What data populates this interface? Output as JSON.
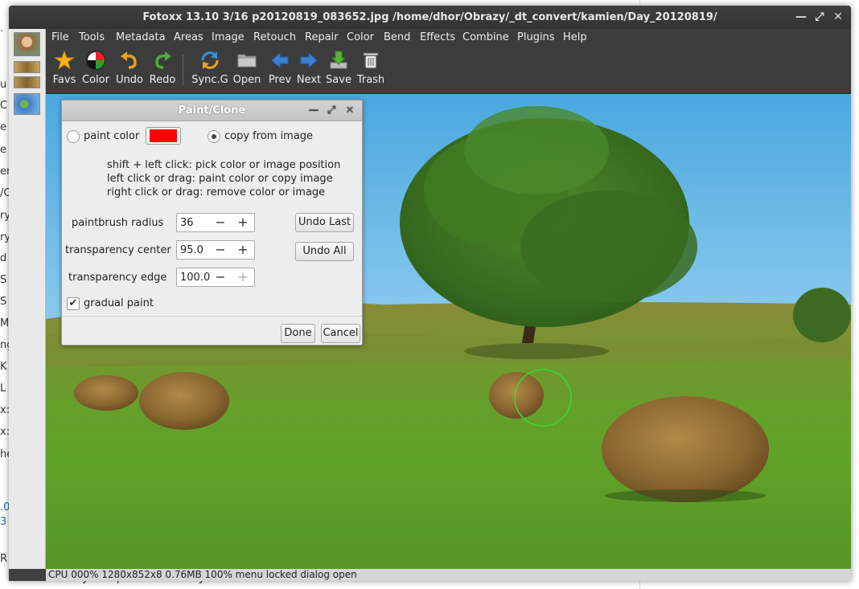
{
  "background": {
    "lines": [
      ".",
      "u",
      "C",
      "e",
      "e",
      "en",
      "/C",
      "ry",
      "ry",
      "d r",
      "S",
      "S",
      "M",
      "ng",
      "K",
      "L",
      "x:",
      "x:",
      "he",
      ".0",
      "3",
      "R"
    ],
    "bottom_text": "k\" once they completed normally."
  },
  "window": {
    "title": "Fotoxx 13.10  3/16  p20120819_083652.jpg  /home/dhor/Obrazy/_dt_convert/kamien/Day_20120819/"
  },
  "menu": [
    "File",
    "Tools",
    "Metadata",
    "Areas",
    "Image",
    "Retouch",
    "Repair",
    "Color",
    "Bend",
    "Effects",
    "Combine",
    "Plugins",
    "Help"
  ],
  "toolbar": {
    "favs": "Favs",
    "color": "Color",
    "undo": "Undo",
    "redo": "Redo",
    "sync": "Sync.G",
    "open": "Open",
    "prev": "Prev",
    "next": "Next",
    "save": "Save",
    "trash": "Trash"
  },
  "status": "CPU 000%  1280x852x8  0.76MB  100%  menu locked  dialog open",
  "dialog": {
    "title": "Paint/Clone",
    "paint_color_label": "paint color",
    "paint_color_value": "#ff0000",
    "copy_label": "copy from image",
    "mode_selected": "copy from image",
    "help": [
      "shift + left click: pick color or image position",
      "left click or drag: paint color or copy image",
      "right click or drag: remove color or image"
    ],
    "radius_label": "paintbrush radius",
    "radius_value": "36",
    "tcenter_label": "transparency center",
    "tcenter_value": "95.0",
    "tedge_label": "transparency edge",
    "tedge_value": "100.0",
    "undo_last": "Undo Last",
    "undo_all": "Undo All",
    "gradual_label": "gradual paint",
    "gradual_checked": true,
    "done": "Done",
    "cancel": "Cancel"
  }
}
